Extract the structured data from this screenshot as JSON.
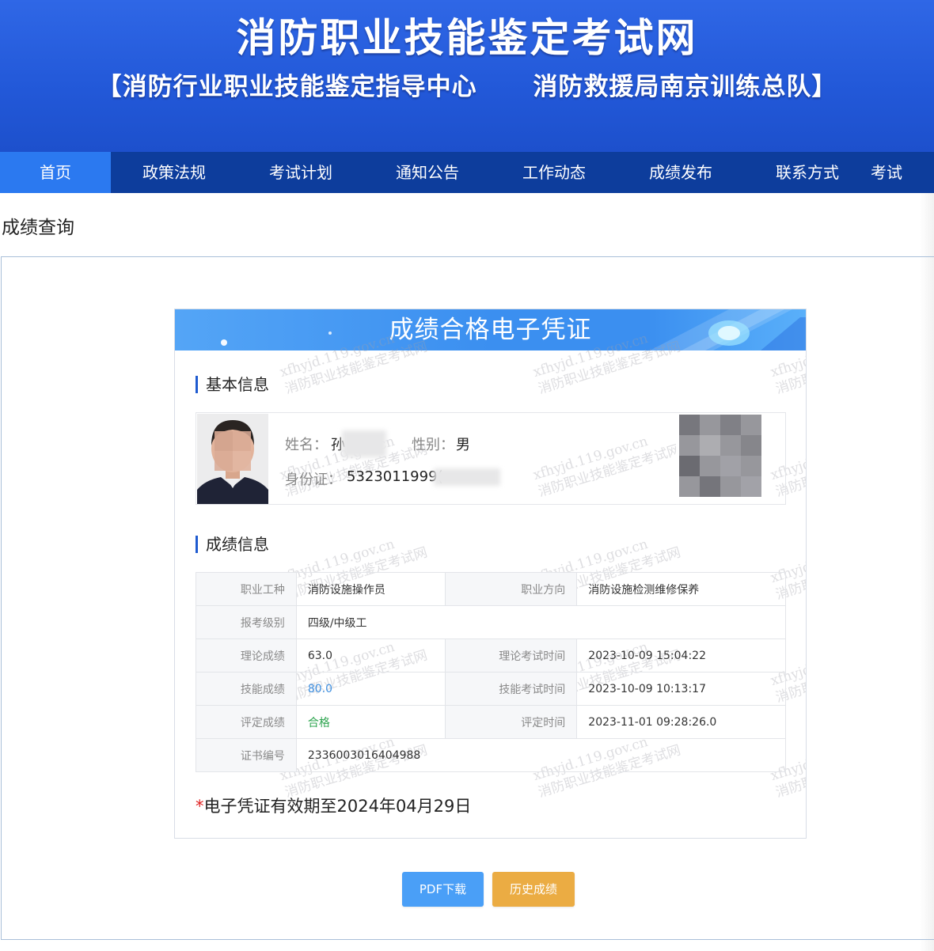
{
  "header": {
    "title": "消防职业技能鉴定考试网",
    "subtitle": "【消防行业职业技能鉴定指导中心      消防救援局南京训练总队】"
  },
  "nav": {
    "items": [
      "首页",
      "政策法规",
      "考试计划",
      "通知公告",
      "工作动态",
      "成绩发布",
      "联系方式",
      "考试"
    ]
  },
  "page": {
    "title": "成绩查询"
  },
  "certificate": {
    "title": "成绩合格电子凭证",
    "watermark_line1": "xfhyjd.119.gov.cn",
    "watermark_line2": "消防职业技能鉴定考试网",
    "basic_info_title": "基本信息",
    "name_label": "姓名：",
    "name_value": "孙",
    "gender_label": "性别：",
    "gender_value": "男",
    "id_label": "身份证：",
    "id_value": "5323011999(",
    "score_info_title": "成绩信息",
    "rows": [
      {
        "l1": "职业工种",
        "v1": "消防设施操作员",
        "l2": "职业方向",
        "v2": "消防设施检测维修保养"
      },
      {
        "l1": "报考级别",
        "v1": "四级/中级工"
      },
      {
        "l1": "理论成绩",
        "v1": "63.0",
        "l2": "理论考试时间",
        "v2": "2023-10-09 15:04:22"
      },
      {
        "l1": "技能成绩",
        "v1": "80.0",
        "l2": "技能考试时间",
        "v2": "2023-10-09 10:13:17"
      },
      {
        "l1": "评定成绩",
        "v1": "合格",
        "l2": "评定时间",
        "v2": "2023-11-01 09:28:26.0"
      },
      {
        "l1": "证书编号",
        "v1": "2336003016404988"
      }
    ],
    "validity_star": "*",
    "validity_text": "电子凭证有效期至2024年04月29日"
  },
  "buttons": {
    "pdf": "PDF下载",
    "history": "历史成绩"
  },
  "colors": {
    "banner": "#2258d8",
    "nav": "#0d3d9c",
    "nav_active": "#2b79f0",
    "pdf_button": "#4a9ff7",
    "history_button": "#ebac43"
  }
}
